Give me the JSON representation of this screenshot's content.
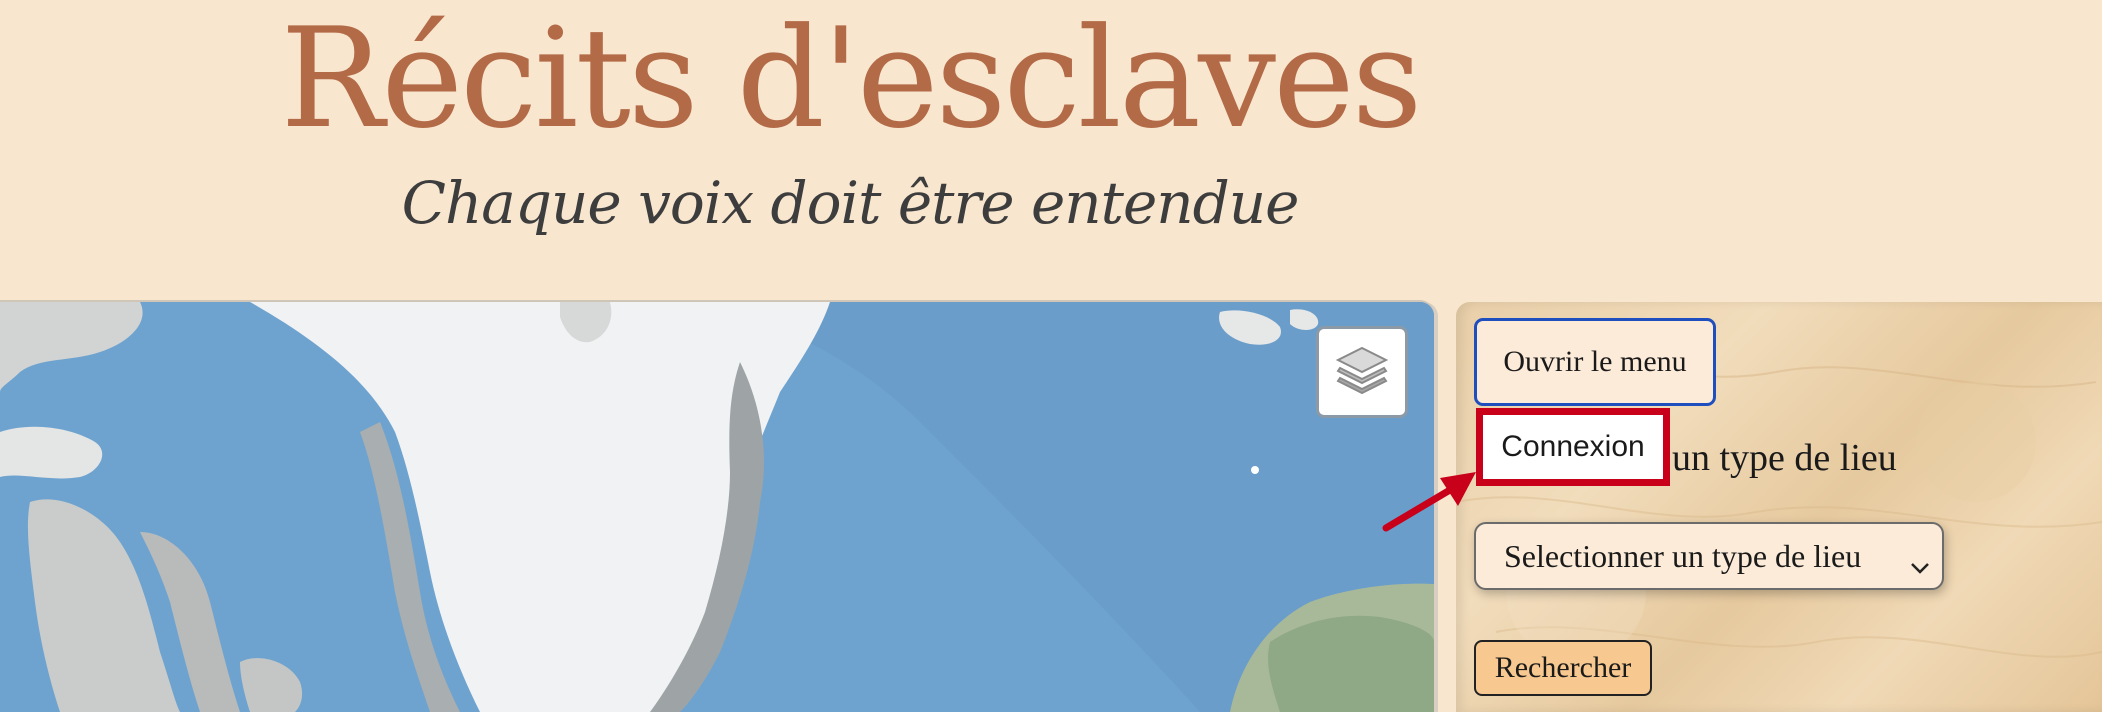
{
  "header": {
    "title": "Récits d'esclaves",
    "tagline": "Chaque voix doit être entendue"
  },
  "map": {
    "layers_icon": "layers-icon",
    "colors": {
      "ocean": "#6fa3cf",
      "ice": "#f3f4f6",
      "land": "#bfc2c0"
    }
  },
  "sidebar": {
    "open_menu_label": "Ouvrir le menu",
    "login_label": "Connexion",
    "place_type_label": "un type de lieu",
    "place_type_select": {
      "selected": "Selectionner un type de lieu"
    },
    "search_label": "Rechercher"
  },
  "colors": {
    "background": "#f8e6cf",
    "title": "#b36a47",
    "focus_outline": "#1f4fbf",
    "highlight": "#c8001a",
    "search_button": "#f7c88f"
  }
}
